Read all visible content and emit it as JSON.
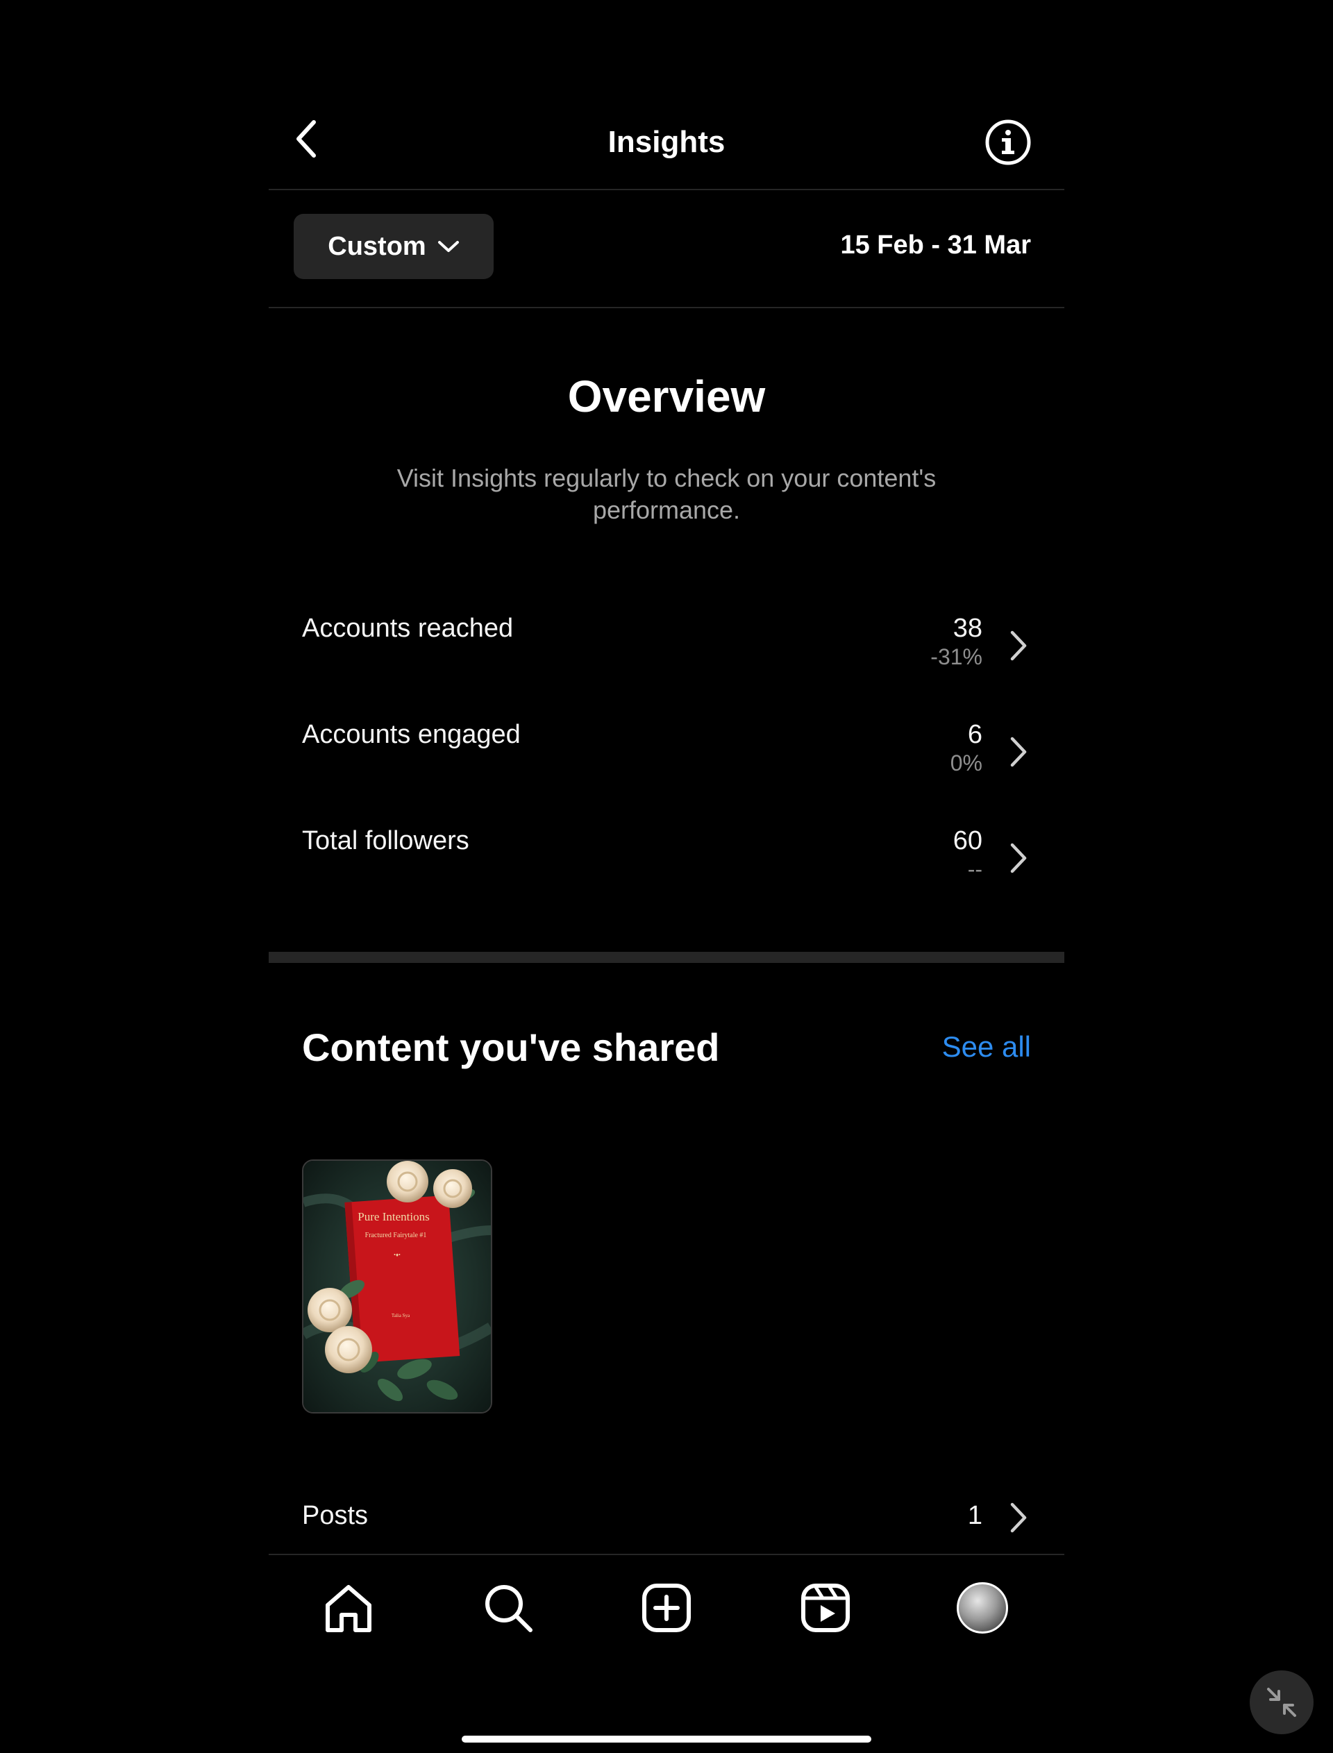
{
  "header": {
    "title": "Insights",
    "back_icon": "chevron-left-icon",
    "info_icon": "info-circle-icon"
  },
  "date_filter": {
    "range_label": "Custom",
    "range_icon": "chevron-down-icon",
    "date_range": "15 Feb - 31 Mar"
  },
  "overview": {
    "title": "Overview",
    "subtitle": "Visit Insights regularly to check on your content's performance.",
    "metrics": [
      {
        "label": "Accounts reached",
        "value": "38",
        "delta": "-31%"
      },
      {
        "label": "Accounts engaged",
        "value": "6",
        "delta": "0%"
      },
      {
        "label": "Total followers",
        "value": "60",
        "delta": "--"
      }
    ]
  },
  "content": {
    "title": "Content you've shared",
    "see_all": "See all",
    "thumbnail": {
      "book_title": "Pure Intentions",
      "book_subtitle": "Fractured Fairytale #1",
      "book_ornament": "•♦•",
      "book_author": "Talia Sya"
    },
    "posts_label": "Posts",
    "posts_count": "1"
  },
  "tabbar": {
    "items": [
      "home-icon",
      "search-icon",
      "create-icon",
      "reels-icon",
      "profile-avatar"
    ]
  },
  "colors": {
    "background": "#000000",
    "link": "#2d8cf0",
    "divider": "#262626",
    "muted_text": "#a8a8a8"
  }
}
